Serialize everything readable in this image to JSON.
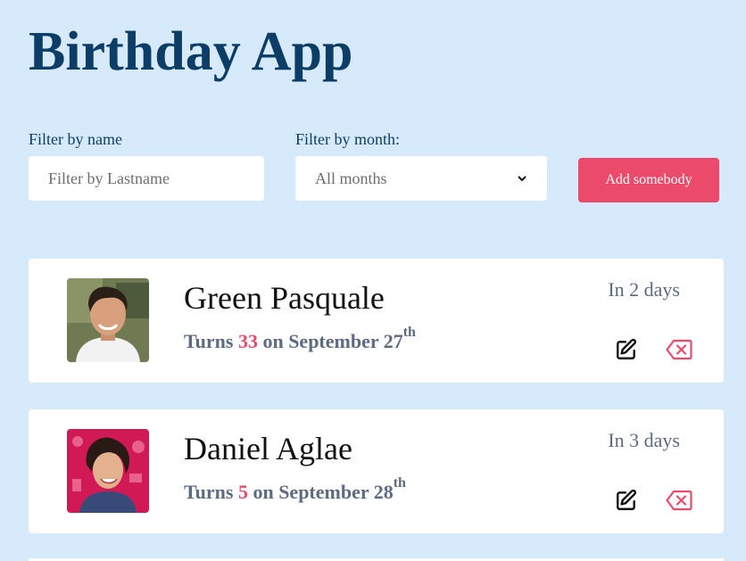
{
  "app": {
    "title": "Birthday App"
  },
  "filters": {
    "name_label": "Filter by name",
    "name_placeholder": "Filter by Lastname",
    "month_label": "Filter by month:",
    "month_selected": "All months"
  },
  "actions": {
    "add_label": "Add somebody"
  },
  "colors": {
    "accent": "#ec4a6a",
    "title": "#0c3d66",
    "background": "#d6eafc"
  },
  "people": [
    {
      "name": "Green Pasquale",
      "turns_prefix": "Turns",
      "age": "33",
      "on_text": "on September 27",
      "suffix": "th",
      "countdown": "In 2 days"
    },
    {
      "name": "Daniel Aglae",
      "turns_prefix": "Turns",
      "age": "5",
      "on_text": "on September 28",
      "suffix": "th",
      "countdown": "In 3 days"
    }
  ]
}
